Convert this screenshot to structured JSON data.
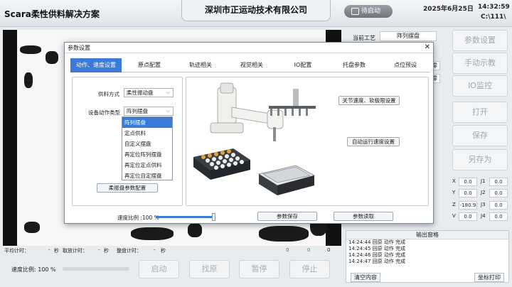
{
  "header": {
    "app_title": "Scara柔性供料解决方案",
    "company": "深圳市正运动技术有限公司",
    "status_button": "待启动",
    "date": "2025年6月25日",
    "time": "14:32:59",
    "path": "C:\\111\\"
  },
  "bottom": {
    "avg_time_label": "平均计时：",
    "pick_time_label": "取放计时：",
    "tray_time_label": "整盘计时：",
    "sec": "秒",
    "dash": "-",
    "count_a": "0",
    "count_b": "0",
    "count_c": "0",
    "speed_label": "速度比例: 100 %",
    "speed_fraction": 1.0,
    "buttons": [
      "启动",
      "找原",
      "暂停",
      "停止"
    ]
  },
  "right_panel": {
    "current_process_label": "当前工艺",
    "current_process_value": "阵列摆盘",
    "zero_a": "零",
    "zero_b": "零",
    "side_buttons": [
      "参数设置",
      "手动示教",
      "IO监控",
      "打开",
      "保存",
      "另存为"
    ],
    "coords": [
      {
        "name": "X",
        "value": "0.0"
      },
      {
        "name": "J1",
        "value": "0.0"
      },
      {
        "name": "Y",
        "value": "0.0"
      },
      {
        "name": "J2",
        "value": "0.0"
      },
      {
        "name": "Z",
        "value": "-180.9"
      },
      {
        "name": "J3",
        "value": "0.0"
      },
      {
        "name": "V",
        "value": "0.0"
      },
      {
        "name": "J4",
        "value": "0.0"
      }
    ],
    "log_title": "输出窗格",
    "log_lines": [
      "14:24:44  回原 动作 完成",
      "14:24:45  回原 动作 完成",
      "14:24:46  回原 动作 完成",
      "14:24:47  回原 动作 完成"
    ],
    "clear_button": "清空内容",
    "print_button": "坐标打印"
  },
  "dialog": {
    "title": "参数设置",
    "close": "✕",
    "tabs": [
      "动作、速度设置",
      "原点配置",
      "轨迹相关",
      "视觉相关",
      "IO配置",
      "托盘参数",
      "点位预设"
    ],
    "active_tab": 0,
    "feed_mode_label": "供料方式",
    "feed_mode_value": "柔性振动盘",
    "action_type_label": "设备动作类型",
    "action_type_value": "阵列摆盘",
    "dropdown_options": [
      "阵列摆盘",
      "定点供料",
      "自定义摆盘",
      "再定位阵列摆盘",
      "再定位定点供料",
      "再定位自定摆盘"
    ],
    "selected_option": 0,
    "vib_config_button": "柔振盘参数配置",
    "joint_speed_button": "关节速度、软极限设置",
    "auto_speed_button": "自动运行速度设置",
    "speed_ratio_label": "速度比例 :100 %",
    "speed_ratio_fraction": 1.0,
    "save_button": "参数保存",
    "read_button": "参数读取"
  },
  "colors": {
    "accent": "#3a7ad8",
    "log_count_red": "#d93030",
    "log_count_green": "#2a9a3a"
  }
}
